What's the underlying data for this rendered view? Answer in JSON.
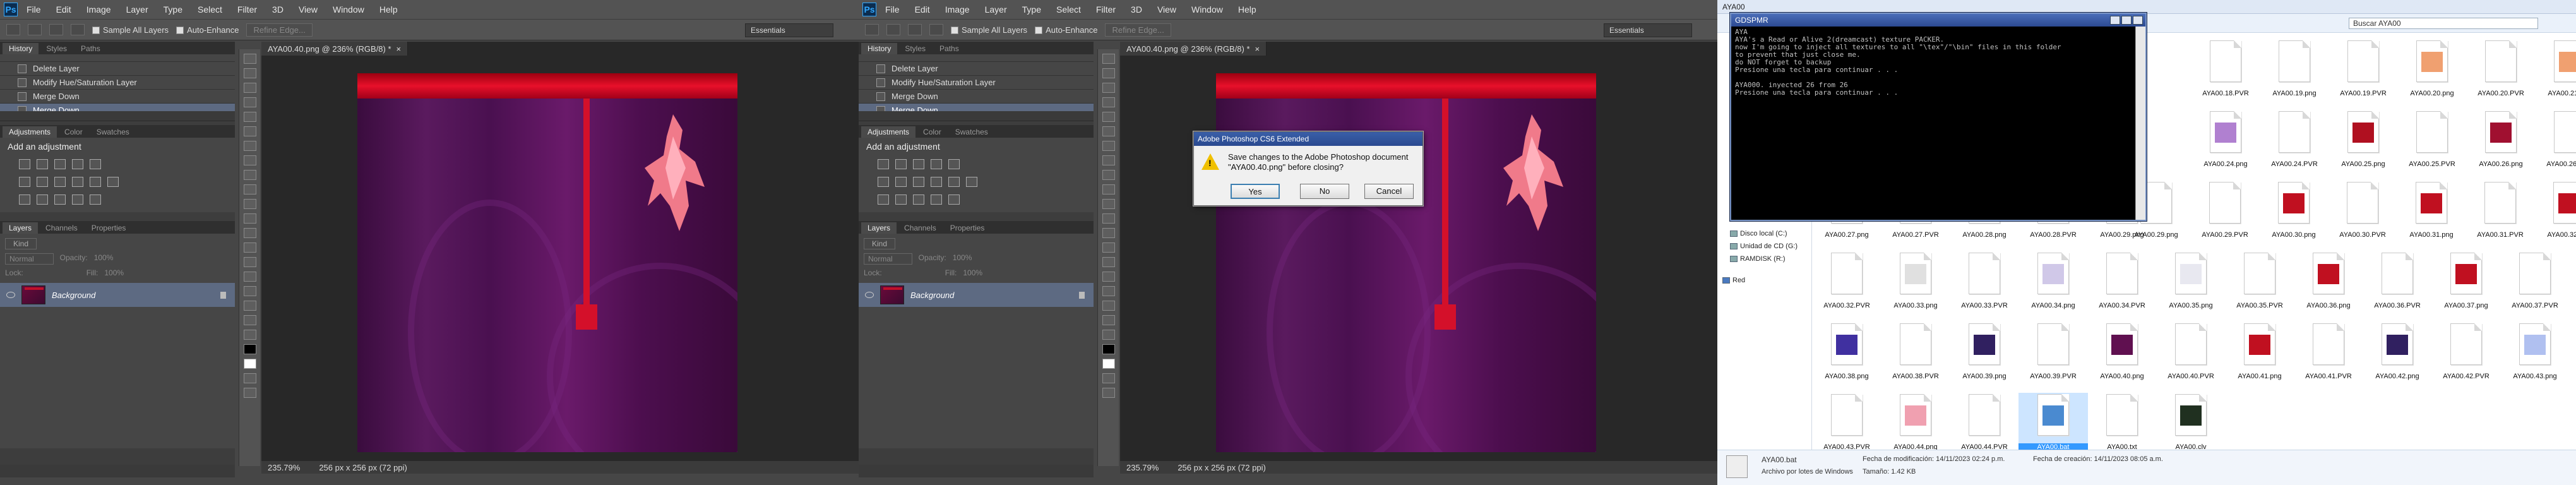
{
  "photoshop": {
    "logo": "Ps",
    "menus": [
      "File",
      "Edit",
      "Image",
      "Layer",
      "Type",
      "Select",
      "Filter",
      "3D",
      "View",
      "Window",
      "Help"
    ],
    "options": {
      "sample_all_layers": "Sample All Layers",
      "auto_enhance": "Auto-Enhance",
      "refine_edge": "Refine Edge..."
    },
    "workspace": "Essentials",
    "history_tabs": [
      "History",
      "Styles",
      "Paths"
    ],
    "history_items": [
      "Delete Layer",
      "Modify Hue/Saturation Layer",
      "Merge Down",
      "Merge Down"
    ],
    "adjust_tabs": [
      "Adjustments",
      "Color",
      "Swatches"
    ],
    "add_adjustment": "Add an adjustment",
    "layer_tabs": [
      "Layers",
      "Channels",
      "Properties"
    ],
    "kind_label": "Kind",
    "blend_mode": "Normal",
    "opacity_label": "Opacity:",
    "opacity_value": "100%",
    "lock_label": "Lock:",
    "fill_label": "Fill:",
    "fill_value": "100%",
    "layer_name": "Background",
    "doc_tab": "AYA00.40.png @ 236% (RGB/8) *",
    "zoom": "235.79%",
    "doc_info": "256 px x 256 px (72 ppi)"
  },
  "dialog": {
    "title": "Adobe Photoshop CS6 Extended",
    "message": "Save changes to the Adobe Photoshop document \"AYA00.40.png\" before closing?",
    "yes": "Yes",
    "no": "No",
    "cancel": "Cancel"
  },
  "explorer": {
    "window_title": "AYA00",
    "search_placeholder": "Buscar AYA00",
    "nav": [
      "Disco local (C:)",
      "Unidad de CD (G:)",
      "RAMDISK (R:)",
      "Red"
    ],
    "details": {
      "name": "AYA00.bat",
      "type": "Archivo por lotes de Windows",
      "modified": "Fecha de modificación: 14/11/2023 02:24 p.m.",
      "size": "Tamaño: 1.42 KB",
      "created": "Fecha de creación: 14/11/2023 08:05 a.m."
    },
    "files": [
      {
        "name": "AYA00.18.PVR",
        "sw": ""
      },
      {
        "name": "AYA00.19.png",
        "sw": ""
      },
      {
        "name": "AYA00.19.PVR",
        "sw": ""
      },
      {
        "name": "AYA00.20.png",
        "sw": "#f0a070"
      },
      {
        "name": "AYA00.20.PVR",
        "sw": ""
      },
      {
        "name": "AYA00.21.png",
        "sw": "#f0a070"
      },
      {
        "name": "AYA00.24.png",
        "sw": "#b080d0"
      },
      {
        "name": "AYA00.24.PVR",
        "sw": ""
      },
      {
        "name": "AYA00.25.png",
        "sw": "#b01020"
      },
      {
        "name": "AYA00.25.PVR",
        "sw": ""
      },
      {
        "name": "AYA00.26.png",
        "sw": "#a01030"
      },
      {
        "name": "AYA00.26.PVR",
        "sw": ""
      },
      {
        "name": "AYA00.29.png",
        "sw": ""
      },
      {
        "name": "AYA00.29.PVR",
        "sw": ""
      },
      {
        "name": "AYA00.30.png",
        "sw": "#c01020"
      },
      {
        "name": "AYA00.30.PVR",
        "sw": ""
      },
      {
        "name": "AYA00.31.png",
        "sw": "#c01020"
      },
      {
        "name": "AYA00.31.PVR",
        "sw": ""
      },
      {
        "name": "AYA00.32.png",
        "sw": "#c01020"
      },
      {
        "name": "AYA00.27.png",
        "sw": ""
      },
      {
        "name": "AYA00.27.PVR",
        "sw": ""
      },
      {
        "name": "AYA00.28.png",
        "sw": ""
      },
      {
        "name": "AYA00.28.PVR",
        "sw": ""
      },
      {
        "name": "AYA00.29.png",
        "sw": ""
      },
      {
        "name": "AYA00.32.PVR",
        "sw": ""
      },
      {
        "name": "AYA00.33.png",
        "sw": "#e0e0e0"
      },
      {
        "name": "AYA00.33.PVR",
        "sw": ""
      },
      {
        "name": "AYA00.34.png",
        "sw": "#d0c8e8"
      },
      {
        "name": "AYA00.34.PVR",
        "sw": ""
      },
      {
        "name": "AYA00.35.png",
        "sw": "#e8e8f0"
      },
      {
        "name": "AYA00.35.PVR",
        "sw": ""
      },
      {
        "name": "AYA00.36.png",
        "sw": "#c01020"
      },
      {
        "name": "AYA00.36.PVR",
        "sw": ""
      },
      {
        "name": "AYA00.37.png",
        "sw": "#c01020"
      },
      {
        "name": "AYA00.37.PVR",
        "sw": ""
      },
      {
        "name": "AYA00.38.png",
        "sw": "#4030a0"
      },
      {
        "name": "AYA00.38.PVR",
        "sw": ""
      },
      {
        "name": "AYA00.39.png",
        "sw": "#302060"
      },
      {
        "name": "AYA00.39.PVR",
        "sw": ""
      },
      {
        "name": "AYA00.40.png",
        "sw": "#601050"
      },
      {
        "name": "AYA00.40.PVR",
        "sw": ""
      },
      {
        "name": "AYA00.41.png",
        "sw": "#c01020"
      },
      {
        "name": "AYA00.41.PVR",
        "sw": ""
      },
      {
        "name": "AYA00.42.png",
        "sw": "#302060"
      },
      {
        "name": "AYA00.42.PVR",
        "sw": ""
      },
      {
        "name": "AYA00.43.png",
        "sw": "#b0c0f0"
      },
      {
        "name": "AYA00.43.PVR",
        "sw": ""
      },
      {
        "name": "AYA00.44.png",
        "sw": "#f0a0b0"
      },
      {
        "name": "AYA00.44.PVR",
        "sw": ""
      },
      {
        "name": "AYA00.bat",
        "sw": "#4a8ad0"
      },
      {
        "name": "AYA00.txt",
        "sw": ""
      },
      {
        "name": "AYA00.clv",
        "sw": "#203020"
      }
    ]
  },
  "console": {
    "title": "GDSPMR",
    "lines": [
      "AYA",
      "AYA's a Read or Alive 2(dreamcast) texture PACKER.",
      "now I'm going to inject all textures to all \"\\tex\"/\"\\bin\" files in this folder",
      "to prevent that just close me.",
      "do NOT forget to backup",
      "Presione una tecla para continuar . . .",
      "",
      "AYA000. inyected 26 from 26",
      "Presione una tecla para continuar . . ."
    ]
  }
}
